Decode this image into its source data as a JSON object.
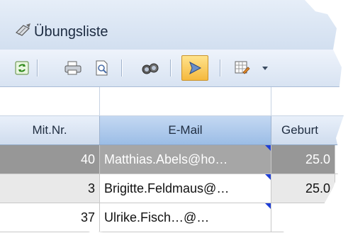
{
  "window": {
    "title": "Übungsliste",
    "title_icon": "notepad-pen-icon"
  },
  "toolbar": {
    "buttons": [
      {
        "name": "refresh-icon"
      },
      {
        "name": "print-icon"
      },
      {
        "name": "print-preview-icon"
      },
      {
        "name": "find-binoculars-icon"
      },
      {
        "name": "play-arrow-icon",
        "active": true
      },
      {
        "name": "export-grid-icon"
      },
      {
        "name": "dropdown-arrow-icon"
      }
    ]
  },
  "grid": {
    "columns": [
      "Mit.Nr.",
      "E-Mail",
      "Geburt"
    ],
    "rows": [
      {
        "nr": "40",
        "email": "Matthias.Abels@ho…",
        "date": "25.0",
        "selected": true
      },
      {
        "nr": "3",
        "email": "Brigitte.Feldmaus@…",
        "date": "25.0"
      },
      {
        "nr": "37",
        "email": "Ulrike.Fisch…@…",
        "date": ""
      }
    ]
  },
  "colors": {
    "accent": "#1f3fd6",
    "selected_row": "#979797",
    "active_button": "#f5b93e"
  }
}
